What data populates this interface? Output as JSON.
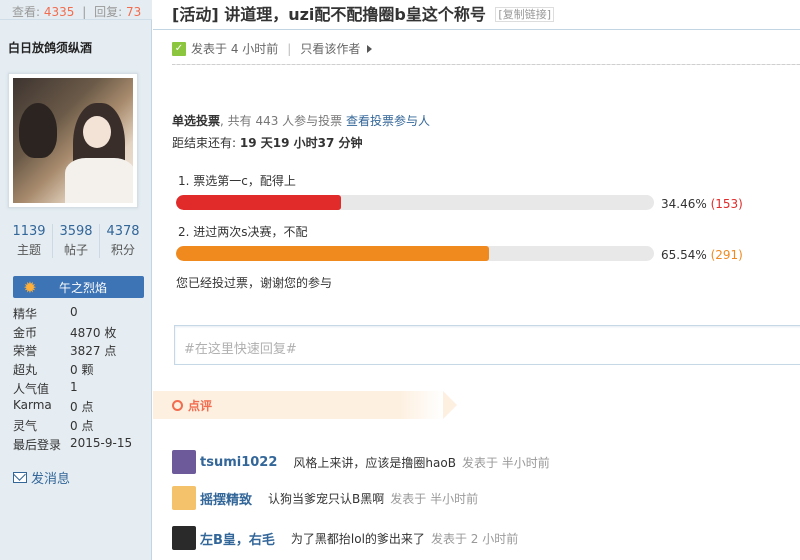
{
  "top_stats": {
    "views_label": "查看:",
    "views": "4335",
    "replies_label": "回复:",
    "replies": "73"
  },
  "author": {
    "name": "白日放鸽须纵酒",
    "counts": [
      {
        "value": "1139",
        "label": "主题"
      },
      {
        "value": "3598",
        "label": "帖子"
      },
      {
        "value": "4378",
        "label": "积分"
      }
    ],
    "medal": "午之烈焰",
    "info": [
      {
        "key": "精华",
        "value": "0"
      },
      {
        "key": "金币",
        "value": "4870 枚"
      },
      {
        "key": "荣誉",
        "value": "3827 点"
      },
      {
        "key": "超丸",
        "value": "0 颗"
      },
      {
        "key": "人气值",
        "value": "1"
      },
      {
        "key": "Karma",
        "value": "0 点"
      },
      {
        "key": "灵气",
        "value": "0 点"
      },
      {
        "key": "最后登录",
        "value": "2015-9-15"
      }
    ],
    "message_link": "发消息"
  },
  "thread": {
    "title": "[活动] 讲道理，uzi配不配撸圈b皇这个称号",
    "copy_link": "[复制链接]",
    "posted": "发表于 4 小时前",
    "only_author": "只看该作者"
  },
  "poll": {
    "type": "单选投票",
    "participants_text": ", 共有 443 人参与投票",
    "view_voters": "查看投票参与人",
    "end_label": "距结束还有:",
    "end_value": "19 天19 小时37 分钟",
    "options": [
      {
        "label": "1.  票选第一c，配得上",
        "percent": 34.46,
        "percent_text": "34.46%",
        "count_text": "(153)",
        "color": "#e12b2b"
      },
      {
        "label": "2.  进过两次s决赛，不配",
        "percent": 65.54,
        "percent_text": "65.54%",
        "count_text": "(291)",
        "color": "#f08a1f"
      }
    ],
    "voted_message": "您已经投过票，谢谢您的参与"
  },
  "reply": {
    "placeholder": "#在这里快速回复#"
  },
  "comments_header": "点评",
  "comments": [
    {
      "name": "tsumi1022",
      "text": "风格上来讲，应该是撸圈haoB",
      "time": "发表于 半小时前",
      "avatar_color": "#6d5a9a"
    },
    {
      "name": "摇摆精致",
      "text": "认狗当爹宠只认B黑啊",
      "time": "发表于 半小时前",
      "avatar_color": "#f3c26a"
    },
    {
      "name": "左B皇，右毛",
      "text": "为了黑都抬lol的爹出来了",
      "time": "发表于 2 小时前",
      "avatar_color": "#2a2a2a"
    }
  ]
}
